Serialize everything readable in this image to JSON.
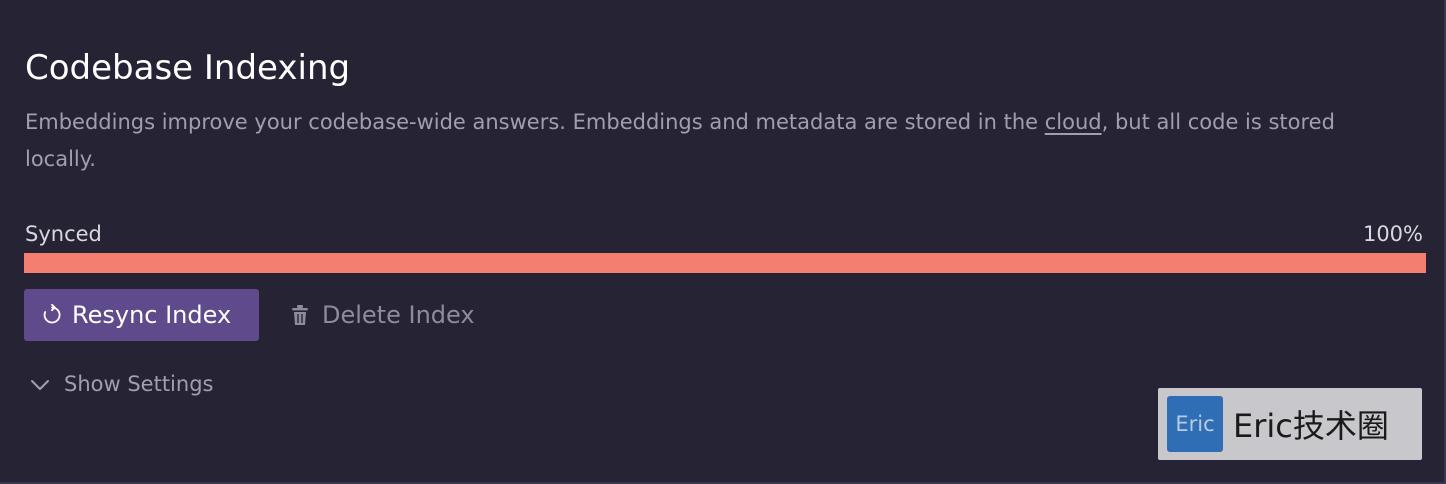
{
  "section": {
    "title": "Codebase Indexing",
    "description_before": "Embeddings improve your codebase-wide answers. Embeddings and metadata are stored in the ",
    "description_link": "cloud",
    "description_after": ", but all code is stored locally."
  },
  "sync": {
    "status_label": "Synced",
    "percent_label": "100%",
    "progress": 1.0,
    "bar_color": "#f47e6f"
  },
  "actions": {
    "resync_label": "Resync Index",
    "resync_icon": "refresh-icon",
    "delete_label": "Delete Index",
    "delete_icon": "trash-icon"
  },
  "settings": {
    "toggle_label": "Show Settings",
    "toggle_icon": "chevron-down-icon"
  },
  "watermark": {
    "logo_text": "Eric",
    "text": "Eric技术圈"
  },
  "colors": {
    "background": "#262335",
    "button": "#5f4a8b"
  }
}
